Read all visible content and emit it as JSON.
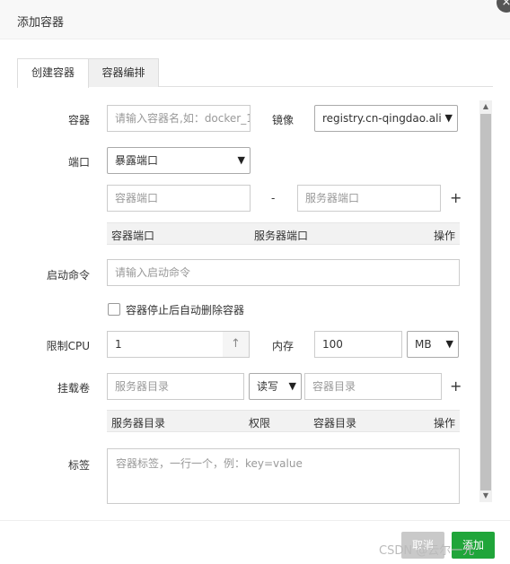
{
  "dialog": {
    "title": "添加容器",
    "close_icon": "×"
  },
  "tabs": [
    {
      "label": "创建容器",
      "active": true
    },
    {
      "label": "容器编排",
      "active": false
    }
  ],
  "form": {
    "container": {
      "label": "容器",
      "placeholder": "请输入容器名,如：docker_1"
    },
    "image": {
      "label": "镜像",
      "value": "registry.cn-qingdao.ali"
    },
    "port": {
      "label": "端口",
      "mode": "暴露端口",
      "container_port_placeholder": "容器端口",
      "dash": "-",
      "server_port_placeholder": "服务器端口",
      "add_icon": "+",
      "table_headers": [
        "容器端口",
        "服务器端口",
        "操作"
      ]
    },
    "start_cmd": {
      "label": "启动命令",
      "placeholder": "请输入启动命令"
    },
    "auto_remove": {
      "label": "容器停止后自动删除容器",
      "checked": false
    },
    "cpu": {
      "label": "限制CPU",
      "value": "1",
      "stepper_icon": "↑"
    },
    "memory": {
      "label": "内存",
      "value": "100",
      "unit": "MB"
    },
    "volume": {
      "label": "挂载卷",
      "server_dir_placeholder": "服务器目录",
      "permission": "读写",
      "container_dir_placeholder": "容器目录",
      "add_icon": "+",
      "table_headers": [
        "服务器目录",
        "权限",
        "容器目录",
        "操作"
      ]
    },
    "tags": {
      "label": "标签",
      "placeholder": "容器标签，一行一个，例：key=value"
    }
  },
  "footer": {
    "cancel_label": "取消",
    "add_label": "添加"
  },
  "watermark": "CSDN @云尔一元",
  "colors": {
    "primary": "#20a53a",
    "cancel": "#c9c9c9"
  }
}
